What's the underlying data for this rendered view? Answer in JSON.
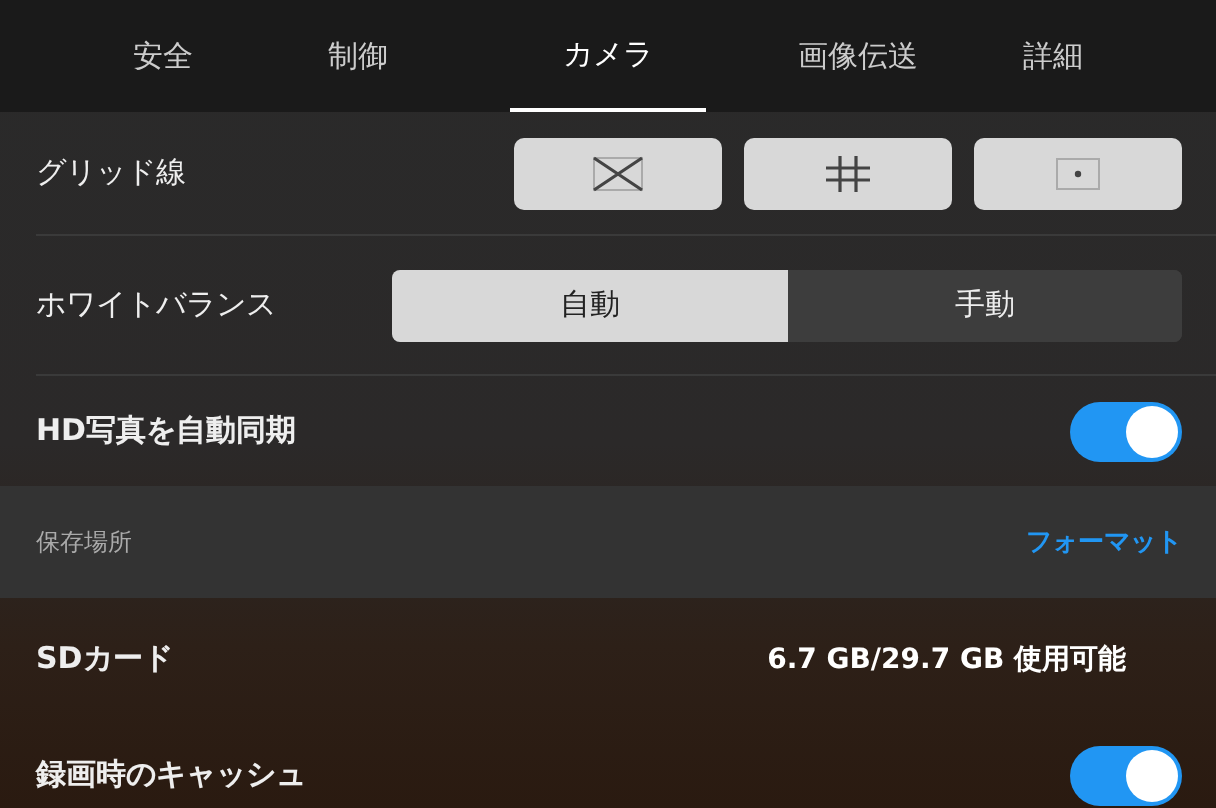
{
  "tabs": [
    {
      "label": "安全",
      "selected": false
    },
    {
      "label": "制御",
      "selected": false
    },
    {
      "label": "カメラ",
      "selected": true
    },
    {
      "label": "画像伝送",
      "selected": false
    },
    {
      "label": "詳細",
      "selected": false
    }
  ],
  "rows": [
    {
      "kind": "grid",
      "label": "グリッド線",
      "options": [
        {
          "kind": "diagonal"
        },
        {
          "kind": "thirds"
        },
        {
          "kind": "center"
        }
      ]
    },
    {
      "kind": "segmented",
      "label": "ホワイトバランス",
      "options": [
        {
          "label": "自動",
          "selected": true
        },
        {
          "label": "手動",
          "selected": false
        }
      ]
    },
    {
      "kind": "toggle",
      "label": "HD写真を自動同期",
      "on": true
    },
    {
      "kind": "section",
      "label": "保存場所",
      "action": "フォーマット"
    },
    {
      "kind": "info",
      "label": "SDカード",
      "value": "6.7 GB/29.7 GB 使用可能"
    },
    {
      "kind": "toggle",
      "label": "録画時のキャッシュ",
      "on": true
    }
  ]
}
